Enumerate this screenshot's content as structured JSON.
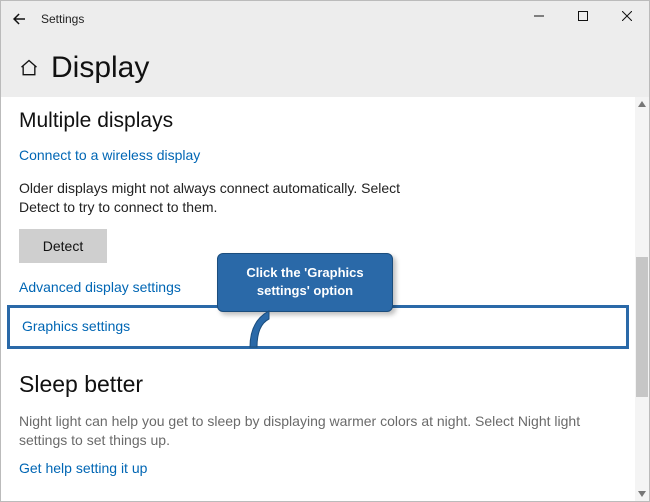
{
  "titlebar": {
    "app_title": "Settings"
  },
  "page": {
    "heading": "Display"
  },
  "multiple_displays": {
    "title": "Multiple displays",
    "connect_link": "Connect to a wireless display",
    "older_text": "Older displays might not always connect automatically. Select Detect to try to connect to them.",
    "detect_button": "Detect",
    "advanced_link": "Advanced display settings",
    "graphics_link": "Graphics settings"
  },
  "sleep": {
    "title": "Sleep better",
    "body": "Night light can help you get to sleep by displaying warmer colors at night. Select Night light settings to set things up.",
    "help_link": "Get help setting it up"
  },
  "callout": {
    "text": "Click the 'Graphics settings' option"
  }
}
